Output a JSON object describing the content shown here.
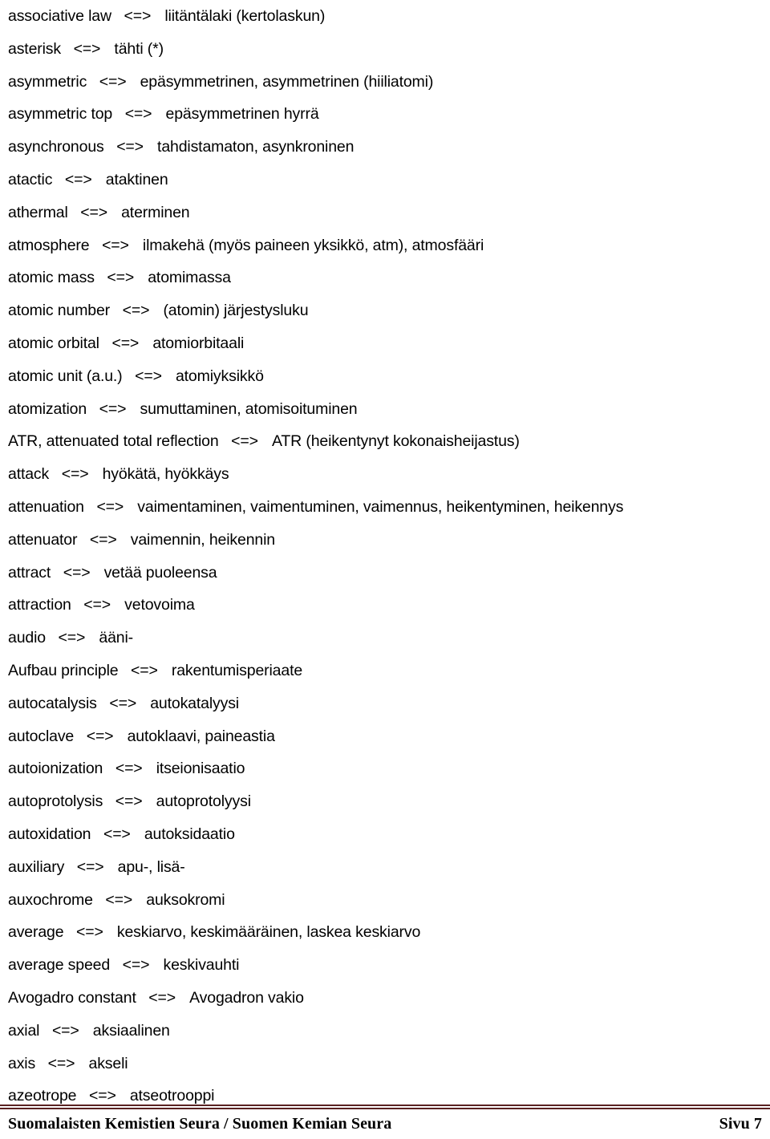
{
  "document": {
    "type": "glossary-page",
    "language_pair": "English <=> Finnish",
    "separator_symbol": "<=>"
  },
  "entries": [
    {
      "term": "associative law",
      "arrow": "<=>",
      "gloss": "liitäntälaki (kertolaskun)"
    },
    {
      "term": "asterisk",
      "arrow": "<=>",
      "gloss": "tähti (*)"
    },
    {
      "term": "asymmetric",
      "arrow": "<=>",
      "gloss": "epäsymmetrinen, asymmetrinen (hiiliatomi)"
    },
    {
      "term": "asymmetric top",
      "arrow": "<=>",
      "gloss": "epäsymmetrinen hyrrä"
    },
    {
      "term": "asynchronous",
      "arrow": "<=>",
      "gloss": "tahdistamaton, asynkroninen"
    },
    {
      "term": "atactic",
      "arrow": "<=>",
      "gloss": "ataktinen"
    },
    {
      "term": "athermal",
      "arrow": "<=>",
      "gloss": "aterminen"
    },
    {
      "term": "atmosphere",
      "arrow": "<=>",
      "gloss": "ilmakehä (myös paineen yksikkö, atm), atmosfääri"
    },
    {
      "term": "atomic mass",
      "arrow": "<=>",
      "gloss": "atomimassa"
    },
    {
      "term": "atomic number",
      "arrow": "<=>",
      "gloss": "(atomin) järjestysluku"
    },
    {
      "term": "atomic orbital",
      "arrow": "<=>",
      "gloss": "atomiorbitaali"
    },
    {
      "term": "atomic unit (a.u.)",
      "arrow": "<=>",
      "gloss": "atomiyksikkö"
    },
    {
      "term": "atomization",
      "arrow": "<=>",
      "gloss": "sumuttaminen, atomisoituminen"
    },
    {
      "term": "ATR, attenuated total reflection",
      "arrow": "<=>",
      "gloss": "ATR (heikentynyt kokonaisheijastus)"
    },
    {
      "term": "attack",
      "arrow": "<=>",
      "gloss": "hyökätä, hyökkäys"
    },
    {
      "term": "attenuation",
      "arrow": "<=>",
      "gloss": "vaimentaminen, vaimentuminen, vaimennus, heikentyminen, heikennys"
    },
    {
      "term": "attenuator",
      "arrow": "<=>",
      "gloss": "vaimennin, heikennin"
    },
    {
      "term": "attract",
      "arrow": "<=>",
      "gloss": "vetää puoleensa"
    },
    {
      "term": "attraction",
      "arrow": "<=>",
      "gloss": "vetovoima"
    },
    {
      "term": "audio",
      "arrow": "<=>",
      "gloss": "ääni-"
    },
    {
      "term": "Aufbau principle",
      "arrow": "<=>",
      "gloss": "rakentumisperiaate"
    },
    {
      "term": "autocatalysis",
      "arrow": "<=>",
      "gloss": "autokatalyysi"
    },
    {
      "term": "autoclave",
      "arrow": "<=>",
      "gloss": "autoklaavi, paineastia"
    },
    {
      "term": "autoionization",
      "arrow": "<=>",
      "gloss": "itseionisaatio"
    },
    {
      "term": "autoprotolysis",
      "arrow": "<=>",
      "gloss": "autoprotolyysi"
    },
    {
      "term": "autoxidation",
      "arrow": "<=>",
      "gloss": "autoksidaatio"
    },
    {
      "term": "auxiliary",
      "arrow": "<=>",
      "gloss": "apu-, lisä-"
    },
    {
      "term": "auxochrome",
      "arrow": "<=>",
      "gloss": "auksokromi"
    },
    {
      "term": "average",
      "arrow": "<=>",
      "gloss": "keskiarvo, keskimääräinen, laskea keskiarvo"
    },
    {
      "term": "average speed",
      "arrow": "<=>",
      "gloss": "keskivauhti"
    },
    {
      "term": "Avogadro constant",
      "arrow": "<=>",
      "gloss": "Avogadron vakio"
    },
    {
      "term": "axial",
      "arrow": "<=>",
      "gloss": "aksiaalinen"
    },
    {
      "term": "axis",
      "arrow": "<=>",
      "gloss": "akseli"
    },
    {
      "term": "azeotrope",
      "arrow": "<=>",
      "gloss": "atseotrooppi"
    }
  ],
  "footer": {
    "organization": "Suomalaisten Kemistien Seura / Suomen Kemian Seura",
    "page_label": "Sivu 7",
    "rule_color": "#5A2222"
  }
}
